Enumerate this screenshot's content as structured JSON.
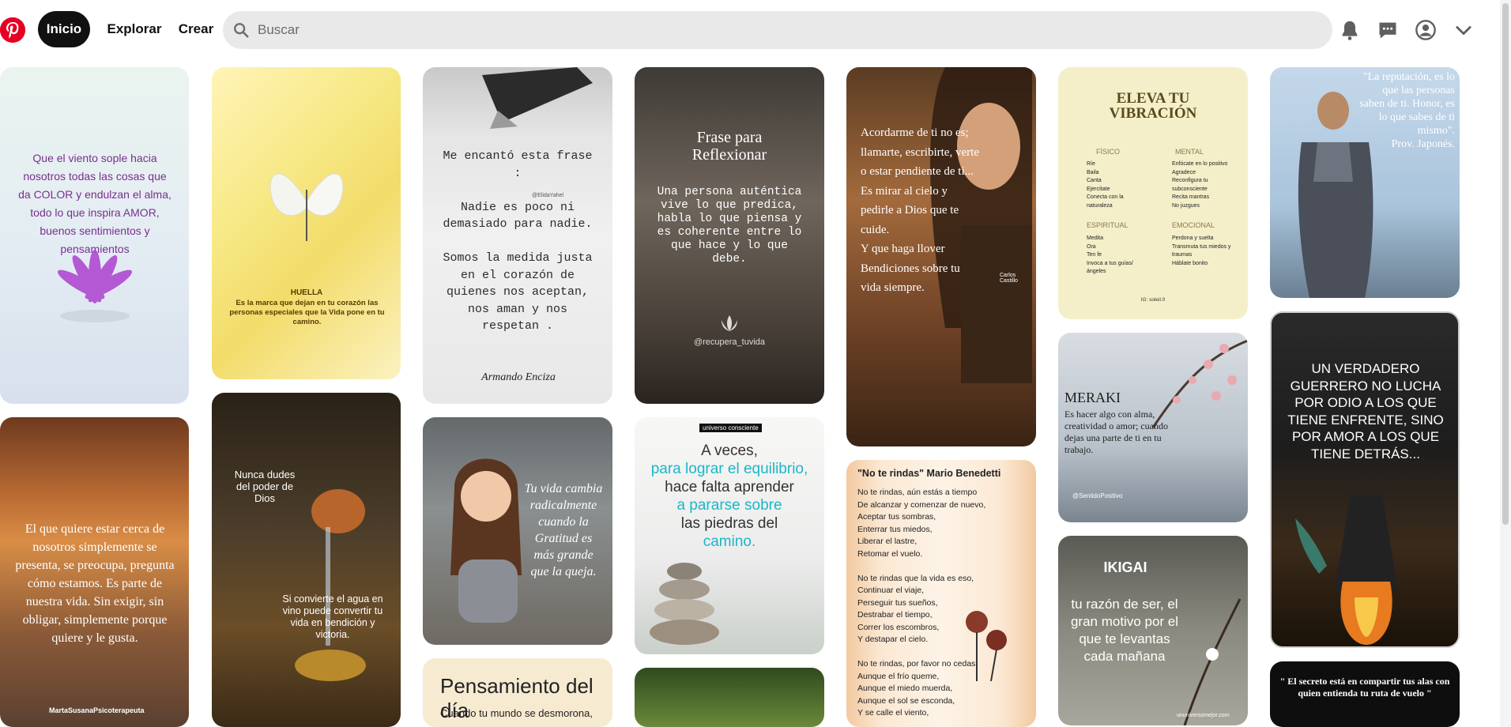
{
  "header": {
    "home_label": "Inicio",
    "explore_label": "Explorar",
    "create_label": "Crear",
    "search_placeholder": "Buscar"
  },
  "icons": {
    "logo": "pinterest-logo",
    "search": "search-icon",
    "notifications": "bell-icon",
    "messages": "chat-icon",
    "profile": "user-circle-icon",
    "menu": "chevron-down-icon"
  },
  "colors": {
    "brand": "#e60023",
    "active_nav": "#111111",
    "search_bg": "#e9e9e9"
  },
  "pins": {
    "p1": {
      "text": "Que el viento sople hacia nosotros todas las cosas que da COLOR y endulzan el alma, todo lo que inspira AMOR, buenos sentimientos y pensamientos"
    },
    "p2": {
      "title": "HUELLA",
      "text": "Es la marca que dejan en tu corazón las personas especiales que la Vida pone en tu camino."
    },
    "p3": {
      "text": "Me encantó esta frase :\n\nNadie es poco ni demasiado para nadie.\n\nSomos la medida justa en el corazón de quienes nos aceptan, nos aman y nos respetan .",
      "handle": "@ElidaYahel",
      "author": "Armando Enciza"
    },
    "p4": {
      "title": "Frase para Reflexionar",
      "text": "Una persona auténtica vive lo que predica, habla lo que piensa y es coherente entre lo que hace y lo que debe.",
      "handle": "@recupera_tuvida"
    },
    "p5": {
      "text": "Acordarme de ti no es; llamarte, escribirte, verte o estar pendiente de ti...\nEs mirar al cielo y pedirle a Dios que te cuide.\nY que haga llover Bendiciones sobre tu vida siempre.",
      "signature": "Carlos Castillo"
    },
    "p6": {
      "title": "ELEVA TU VIBRACIÓN",
      "h1": "FÍSICO",
      "l1": "Ríe\nBaila\nCanta\nEjercítate\nConecta con la naturaleza",
      "h2": "MENTAL",
      "l2": "Enfócate en lo positivo\nAgradece\nReconfigura tu subconsciente\nRecita mantras\nNo juzgues",
      "h3": "ESPIRITUAL",
      "l3": "Medita\nOra\nTen fe\nInvoca a tus guías/ángeles",
      "h4": "EMOCIONAL",
      "l4": "Perdona y suelta\nTransmuta tus miedos y traumas\nHáblate bonito",
      "footer": "IG: soleil.0"
    },
    "p7": {
      "text": "\"La reputación, es lo que las personas saben de ti. Honor, es lo que sabes de ti mismo\".\nProv. Japonés."
    },
    "p8": {
      "text": "El que quiere estar cerca de nosotros simplemente se presenta, se preocupa, pregunta cómo estamos. Es parte de nuestra vida. Sin exigir, sin obligar, simplemente porque quiere y le gusta.",
      "author": "MartaSusanaPsicoterapeuta"
    },
    "p9": {
      "top": "Nunca dudes del poder de Dios",
      "bottom": "Si convierte el agua en vino puede convertir tu vida en bendición y victoria."
    },
    "p10": {
      "text": "Tu vida cambia radicalmente cuando la Gratitud es más grande que la queja."
    },
    "p11": {
      "tag": "universo consciente",
      "line1": "A veces,",
      "line2": "para lograr el equilibrio,",
      "line3": "hace falta aprender",
      "line4": "a pararse sobre",
      "line5": "las piedras del",
      "line6": "camino."
    },
    "p12": {
      "title": "\"No te rindas\" Mario Benedetti",
      "text": "No te rindas, aún estás a tiempo\nDe alcanzar y comenzar de nuevo,\nAceptar tus sombras,\nEnterrar tus miedos,\nLiberar el lastre,\nRetomar el vuelo.\n\nNo te rindas que la vida es eso,\nContinuar el viaje,\nPerseguir tus sueños,\nDestrabar el tiempo,\nCorrer los escombros,\nY destapar el cielo.\n\nNo te rindas, por favor no cedas,\nAunque el frío queme,\nAunque el miedo muerda,\nAunque el sol se esconda,\nY se calle el viento,"
    },
    "p13": {
      "title": "MERAKI",
      "text": "Es hacer algo con alma, creatividad o amor; cuando dejas una parte de ti en tu trabajo.",
      "handle": "@SentidoPositivo"
    },
    "p14": {
      "text": "UN VERDADERO GUERRERO NO LUCHA POR ODIO A LOS QUE TIENE ENFRENTE, SINO POR AMOR A LOS QUE TIENE DETRÁS..."
    },
    "p15": {
      "title": "IKIGAI",
      "text": "tu razón de ser, el gran motivo por el que te levantas cada mañana",
      "handle": "ununiversomejor.com"
    },
    "p16": {
      "title": "Pensamiento del día",
      "text": "Cuando tu mundo se desmorona,"
    },
    "p18": {
      "text": "\" El secreto está en compartir tus alas con quien entienda tu ruta de vuelo \""
    }
  }
}
